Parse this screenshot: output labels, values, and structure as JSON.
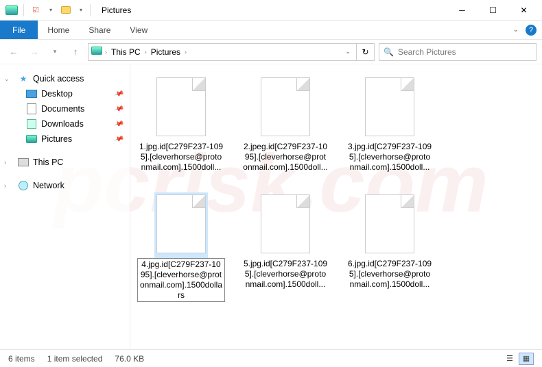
{
  "titlebar": {
    "title": "Pictures"
  },
  "ribbon": {
    "file": "File",
    "tabs": [
      "Home",
      "Share",
      "View"
    ]
  },
  "nav": {
    "crumbs": [
      "This PC",
      "Pictures"
    ],
    "search_placeholder": "Search Pictures"
  },
  "sidebar": {
    "quick": "Quick access",
    "items": [
      {
        "label": "Desktop",
        "pinned": true
      },
      {
        "label": "Documents",
        "pinned": true
      },
      {
        "label": "Downloads",
        "pinned": true
      },
      {
        "label": "Pictures",
        "pinned": true
      }
    ],
    "thispc": "This PC",
    "network": "Network"
  },
  "files": [
    {
      "name": "1.jpg.id[C279F237-1095].[cleverhorse@protonmail.com].1500doll...",
      "selected": false
    },
    {
      "name": "2.jpeg.id[C279F237-1095].[cleverhorse@protonmail.com].1500doll...",
      "selected": false
    },
    {
      "name": "3.jpg.id[C279F237-1095].[cleverhorse@protonmail.com].1500doll...",
      "selected": false
    },
    {
      "name": "4.jpg.id[C279F237-1095].[cleverhorse@protonmail.com].1500dollars",
      "selected": true
    },
    {
      "name": "5.jpg.id[C279F237-1095].[cleverhorse@protonmail.com].1500doll...",
      "selected": false
    },
    {
      "name": "6.jpg.id[C279F237-1095].[cleverhorse@protonmail.com].1500doll...",
      "selected": false
    }
  ],
  "status": {
    "count": "6 items",
    "selection": "1 item selected",
    "size": "76.0 KB"
  },
  "watermark": "pcrisk.com"
}
